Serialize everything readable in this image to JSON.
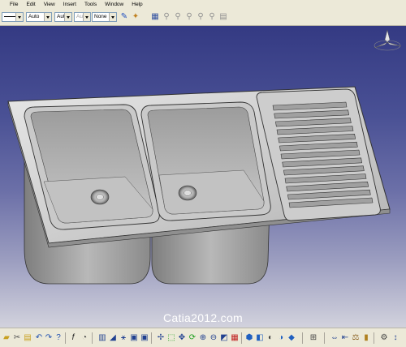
{
  "menu": {
    "items": [
      "File",
      "Edit",
      "View",
      "Insert",
      "Tools",
      "Window",
      "Help"
    ]
  },
  "toolbar": {
    "color_value": "Auto",
    "linetype_value": "Aut",
    "thickness_value": "Aut",
    "layer_value": "None"
  },
  "watermark": "Catia2012.com"
}
